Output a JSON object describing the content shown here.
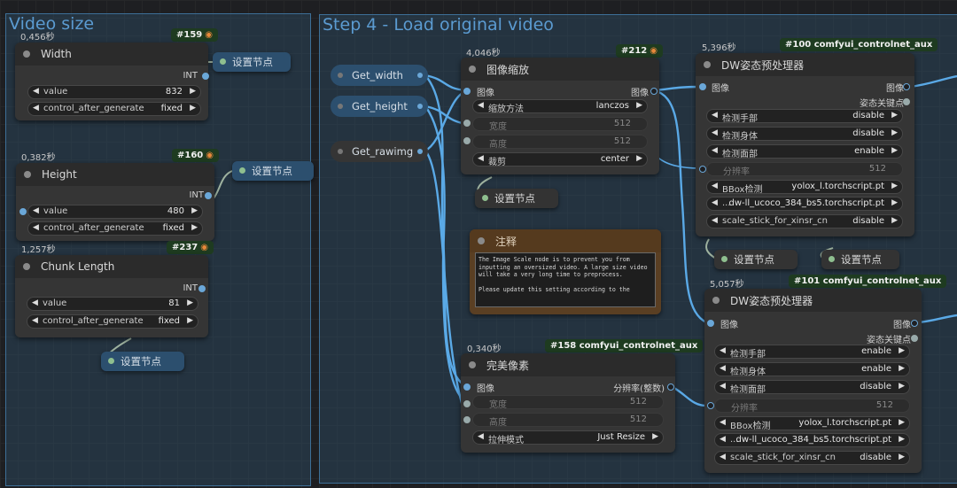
{
  "groups": {
    "video_size": {
      "title": "Video size"
    },
    "step4": {
      "title": "Step 4 - Load original video"
    }
  },
  "colors": {
    "wire": "#5aa9e6",
    "group_border": "#3d6f97",
    "badge_bg": "#1e3b20",
    "reroute": "#2c4f6e"
  },
  "nodes": {
    "width": {
      "timing": "0,456秒",
      "badge": "#159",
      "title": "Width",
      "output": "INT",
      "widgets": [
        {
          "label": "value",
          "value": "832"
        },
        {
          "label": "control_after_generate",
          "value": "fixed"
        }
      ]
    },
    "height": {
      "timing": "0,382秒",
      "badge": "#160",
      "title": "Height",
      "output": "INT",
      "widgets": [
        {
          "label": "value",
          "value": "480"
        },
        {
          "label": "control_after_generate",
          "value": "fixed"
        }
      ]
    },
    "chunk": {
      "timing": "1,257秒",
      "badge": "#237",
      "title": "Chunk Length",
      "output": "INT",
      "widgets": [
        {
          "label": "value",
          "value": "81"
        },
        {
          "label": "control_after_generate",
          "value": "fixed"
        }
      ]
    },
    "scale": {
      "timing": "4,046秒",
      "badge": "#212",
      "title": "图像缩放",
      "input": "图像",
      "output": "图像",
      "widgets": [
        {
          "label": "缩放方法",
          "value": "lanczos"
        },
        {
          "label": "宽度",
          "value": "512"
        },
        {
          "label": "高度",
          "value": "512"
        },
        {
          "label": "裁剪",
          "value": "center"
        }
      ]
    },
    "pixel": {
      "timing": "0,340秒",
      "badge": "#158 comfyui_controlnet_aux",
      "title": "完美像素",
      "input": "图像",
      "output": "分辨率(整数)",
      "widgets": [
        {
          "label": "宽度",
          "value": "512"
        },
        {
          "label": "高度",
          "value": "512"
        },
        {
          "label": "拉伸模式",
          "value": "Just Resize"
        }
      ]
    },
    "dw1": {
      "timing": "5,396秒",
      "badge": "#100 comfyui_controlnet_aux",
      "title": "DW姿态预处理器",
      "input": "图像",
      "output1": "图像",
      "output2": "姿态关键点",
      "widgets": [
        {
          "label": "检测手部",
          "value": "disable"
        },
        {
          "label": "检测身体",
          "value": "disable"
        },
        {
          "label": "检测面部",
          "value": "enable"
        },
        {
          "label": "分辨率",
          "value": "512"
        },
        {
          "label": "BBox检测",
          "value": "yolox_l.torchscript.pt"
        },
        {
          "label": "...",
          "value": "dw-ll_ucoco_384_bs5.torchscript.pt"
        },
        {
          "label": "scale_stick_for_xinsr_cn",
          "value": "disable"
        }
      ]
    },
    "dw2": {
      "timing": "5,057秒",
      "badge": "#101 comfyui_controlnet_aux",
      "title": "DW姿态预处理器",
      "input": "图像",
      "output1": "图像",
      "output2": "姿态关键点",
      "widgets": [
        {
          "label": "检测手部",
          "value": "enable"
        },
        {
          "label": "检测身体",
          "value": "enable"
        },
        {
          "label": "检测面部",
          "value": "disable"
        },
        {
          "label": "分辨率",
          "value": "512"
        },
        {
          "label": "BBox检测",
          "value": "yolox_l.torchscript.pt"
        },
        {
          "label": "...",
          "value": "dw-ll_ucoco_384_bs5.torchscript.pt"
        },
        {
          "label": "scale_stick_for_xinsr_cn",
          "value": "disable"
        }
      ]
    }
  },
  "note": {
    "title": "注释",
    "text": "The Image Scale node is to prevent you from inputting an oversized video. A large size video will take a very long time to preprocess.\n\nPlease update this setting according to the"
  },
  "set_nodes": {
    "label": "设置节点"
  },
  "get_nodes": {
    "width": "Get_width",
    "height": "Get_height",
    "rawimg": "Get_rawimg"
  },
  "icons": {
    "fox": "fox-icon",
    "dot": "collapse-dot-icon",
    "arrow_left": "arrow-left-icon",
    "arrow_right": "arrow-right-icon"
  }
}
